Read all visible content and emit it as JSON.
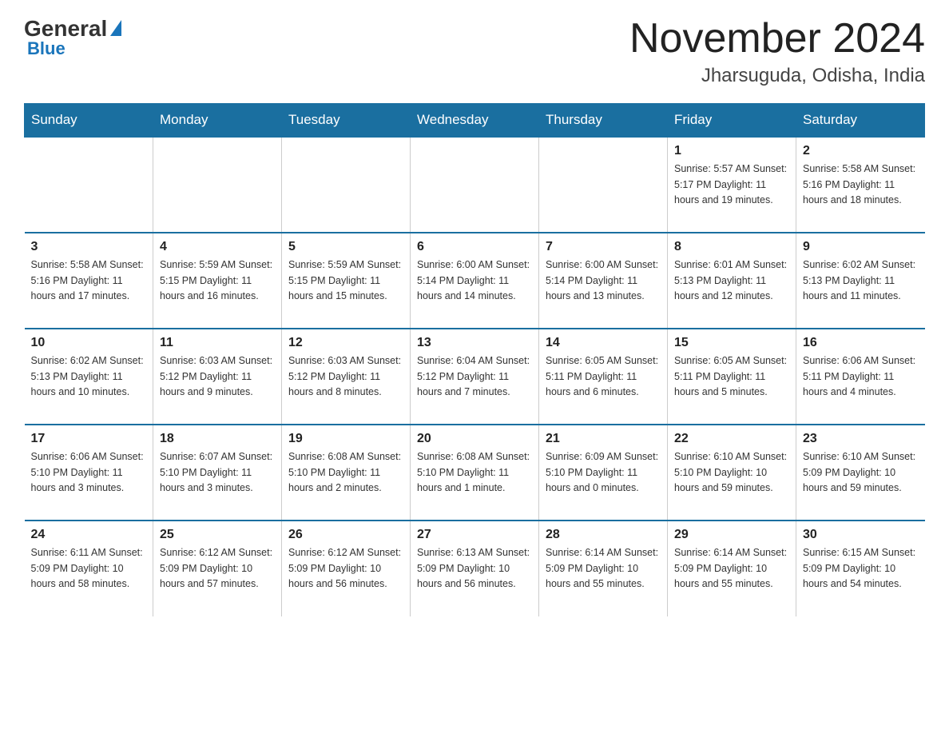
{
  "header": {
    "logo": {
      "general": "General",
      "blue": "Blue"
    },
    "title": "November 2024",
    "location": "Jharsuguda, Odisha, India"
  },
  "weekdays": [
    "Sunday",
    "Monday",
    "Tuesday",
    "Wednesday",
    "Thursday",
    "Friday",
    "Saturday"
  ],
  "weeks": [
    [
      {
        "day": "",
        "info": ""
      },
      {
        "day": "",
        "info": ""
      },
      {
        "day": "",
        "info": ""
      },
      {
        "day": "",
        "info": ""
      },
      {
        "day": "",
        "info": ""
      },
      {
        "day": "1",
        "info": "Sunrise: 5:57 AM\nSunset: 5:17 PM\nDaylight: 11 hours\nand 19 minutes."
      },
      {
        "day": "2",
        "info": "Sunrise: 5:58 AM\nSunset: 5:16 PM\nDaylight: 11 hours\nand 18 minutes."
      }
    ],
    [
      {
        "day": "3",
        "info": "Sunrise: 5:58 AM\nSunset: 5:16 PM\nDaylight: 11 hours\nand 17 minutes."
      },
      {
        "day": "4",
        "info": "Sunrise: 5:59 AM\nSunset: 5:15 PM\nDaylight: 11 hours\nand 16 minutes."
      },
      {
        "day": "5",
        "info": "Sunrise: 5:59 AM\nSunset: 5:15 PM\nDaylight: 11 hours\nand 15 minutes."
      },
      {
        "day": "6",
        "info": "Sunrise: 6:00 AM\nSunset: 5:14 PM\nDaylight: 11 hours\nand 14 minutes."
      },
      {
        "day": "7",
        "info": "Sunrise: 6:00 AM\nSunset: 5:14 PM\nDaylight: 11 hours\nand 13 minutes."
      },
      {
        "day": "8",
        "info": "Sunrise: 6:01 AM\nSunset: 5:13 PM\nDaylight: 11 hours\nand 12 minutes."
      },
      {
        "day": "9",
        "info": "Sunrise: 6:02 AM\nSunset: 5:13 PM\nDaylight: 11 hours\nand 11 minutes."
      }
    ],
    [
      {
        "day": "10",
        "info": "Sunrise: 6:02 AM\nSunset: 5:13 PM\nDaylight: 11 hours\nand 10 minutes."
      },
      {
        "day": "11",
        "info": "Sunrise: 6:03 AM\nSunset: 5:12 PM\nDaylight: 11 hours\nand 9 minutes."
      },
      {
        "day": "12",
        "info": "Sunrise: 6:03 AM\nSunset: 5:12 PM\nDaylight: 11 hours\nand 8 minutes."
      },
      {
        "day": "13",
        "info": "Sunrise: 6:04 AM\nSunset: 5:12 PM\nDaylight: 11 hours\nand 7 minutes."
      },
      {
        "day": "14",
        "info": "Sunrise: 6:05 AM\nSunset: 5:11 PM\nDaylight: 11 hours\nand 6 minutes."
      },
      {
        "day": "15",
        "info": "Sunrise: 6:05 AM\nSunset: 5:11 PM\nDaylight: 11 hours\nand 5 minutes."
      },
      {
        "day": "16",
        "info": "Sunrise: 6:06 AM\nSunset: 5:11 PM\nDaylight: 11 hours\nand 4 minutes."
      }
    ],
    [
      {
        "day": "17",
        "info": "Sunrise: 6:06 AM\nSunset: 5:10 PM\nDaylight: 11 hours\nand 3 minutes."
      },
      {
        "day": "18",
        "info": "Sunrise: 6:07 AM\nSunset: 5:10 PM\nDaylight: 11 hours\nand 3 minutes."
      },
      {
        "day": "19",
        "info": "Sunrise: 6:08 AM\nSunset: 5:10 PM\nDaylight: 11 hours\nand 2 minutes."
      },
      {
        "day": "20",
        "info": "Sunrise: 6:08 AM\nSunset: 5:10 PM\nDaylight: 11 hours\nand 1 minute."
      },
      {
        "day": "21",
        "info": "Sunrise: 6:09 AM\nSunset: 5:10 PM\nDaylight: 11 hours\nand 0 minutes."
      },
      {
        "day": "22",
        "info": "Sunrise: 6:10 AM\nSunset: 5:10 PM\nDaylight: 10 hours\nand 59 minutes."
      },
      {
        "day": "23",
        "info": "Sunrise: 6:10 AM\nSunset: 5:09 PM\nDaylight: 10 hours\nand 59 minutes."
      }
    ],
    [
      {
        "day": "24",
        "info": "Sunrise: 6:11 AM\nSunset: 5:09 PM\nDaylight: 10 hours\nand 58 minutes."
      },
      {
        "day": "25",
        "info": "Sunrise: 6:12 AM\nSunset: 5:09 PM\nDaylight: 10 hours\nand 57 minutes."
      },
      {
        "day": "26",
        "info": "Sunrise: 6:12 AM\nSunset: 5:09 PM\nDaylight: 10 hours\nand 56 minutes."
      },
      {
        "day": "27",
        "info": "Sunrise: 6:13 AM\nSunset: 5:09 PM\nDaylight: 10 hours\nand 56 minutes."
      },
      {
        "day": "28",
        "info": "Sunrise: 6:14 AM\nSunset: 5:09 PM\nDaylight: 10 hours\nand 55 minutes."
      },
      {
        "day": "29",
        "info": "Sunrise: 6:14 AM\nSunset: 5:09 PM\nDaylight: 10 hours\nand 55 minutes."
      },
      {
        "day": "30",
        "info": "Sunrise: 6:15 AM\nSunset: 5:09 PM\nDaylight: 10 hours\nand 54 minutes."
      }
    ]
  ]
}
